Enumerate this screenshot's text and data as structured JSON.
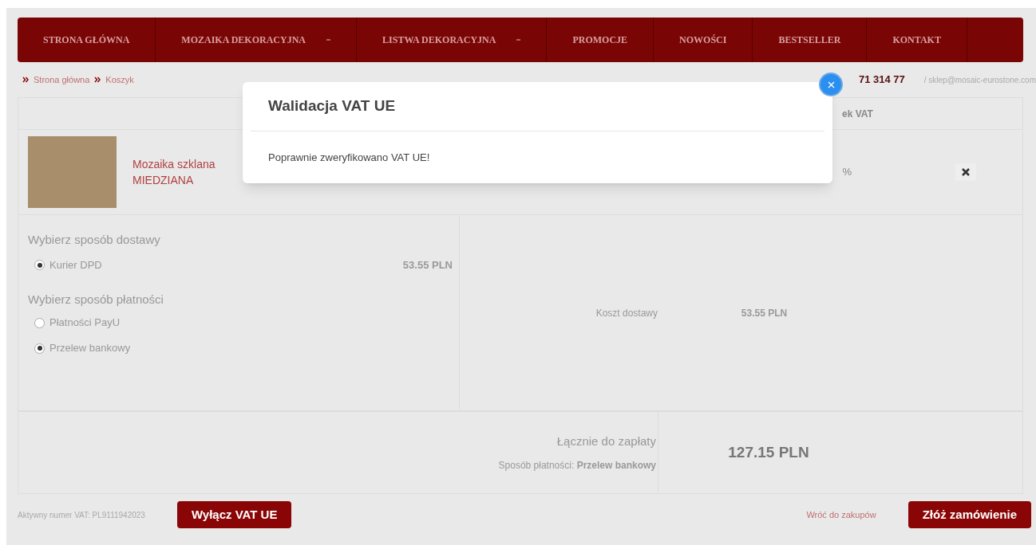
{
  "nav": [
    {
      "label": "STRONA GŁÓWNA",
      "dropdown": false
    },
    {
      "label": "MOZAIKA DEKORACYJNA",
      "dropdown": true
    },
    {
      "label": "LISTWA DEKORACYJNA",
      "dropdown": true
    },
    {
      "label": "PROMOCJE",
      "dropdown": false
    },
    {
      "label": "NOWOŚCI",
      "dropdown": false
    },
    {
      "label": "BESTSELLER",
      "dropdown": false
    },
    {
      "label": "KONTAKT",
      "dropdown": false
    }
  ],
  "breadcrumb": [
    "Strona główna",
    "Koszyk"
  ],
  "contact": {
    "phone": "71 314 77",
    "email": "/ sklep@mosaic-eurostone.com"
  },
  "cart": {
    "header_partial": "ek VAT",
    "item": {
      "name_lines": [
        "Mozaika szklana",
        "MIEDZIANA"
      ],
      "vat_partial": "%"
    }
  },
  "delivery": {
    "heading": "Wybierz sposób dostawy",
    "options": [
      {
        "label": "Kurier DPD",
        "price": "53.55 PLN",
        "selected": true
      }
    ]
  },
  "payment": {
    "heading": "Wybierz sposób płatności",
    "options": [
      {
        "label": "Płatności PayU",
        "selected": false
      },
      {
        "label": "Przelew bankowy",
        "selected": true
      }
    ]
  },
  "summary": {
    "shipping_label": "Koszt dostawy",
    "shipping_value": "53.55 PLN",
    "total_label": "Łącznie do zapłaty",
    "payment_method": "Sposób płatności: **Przelew bankowy**",
    "total_value": "127.15 PLN"
  },
  "footer": {
    "vat_number": "Aktywny numer VAT: PL9111942023",
    "disable_vat_button": "Wyłącz VAT UE",
    "back_link": "Wróć do zakupów",
    "order_button": "Złóż zamówienie"
  },
  "modal": {
    "title": "Walidacja VAT UE",
    "message": "Poprawnie zweryfikowano VAT UE!"
  }
}
